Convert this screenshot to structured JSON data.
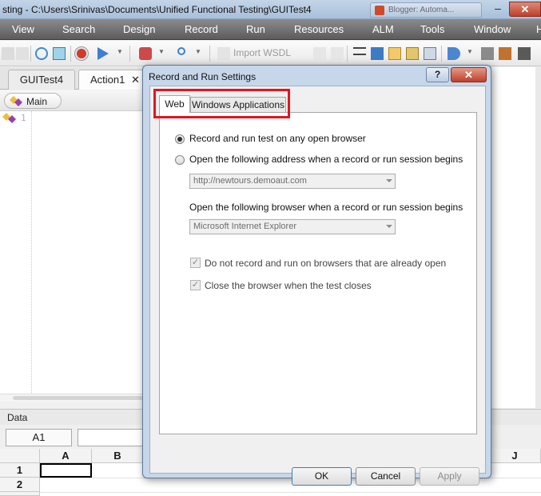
{
  "window": {
    "title": "sting - C:\\Users\\Srinivas\\Documents\\Unified Functional Testing\\GUITest4",
    "background_tab": "Blogger: Automa..."
  },
  "menu": {
    "items": [
      "View",
      "Search",
      "Design",
      "Record",
      "Run",
      "Resources",
      "ALM",
      "Tools",
      "Window",
      "H"
    ]
  },
  "toolbar": {
    "import_wsdl": "Import WSDL"
  },
  "doc_tabs": {
    "tab1": "GUITest4",
    "tab2": "Action1",
    "close": "✕"
  },
  "editor": {
    "main_label": "Main",
    "line_number": "1"
  },
  "data_pane": {
    "title": "Data",
    "cell_ref": "A1",
    "columns": [
      "A",
      "B",
      "J"
    ],
    "rows": [
      "1",
      "2"
    ]
  },
  "dialog": {
    "title": "Record and Run Settings",
    "help": "?",
    "close": "✕",
    "tabs": {
      "web": "Web",
      "windows_apps": "Windows Applications"
    },
    "radio_any_browser": "Record and run test on any open browser",
    "radio_address": "Open the following address when a record or run session begins",
    "address_value": "http://newtours.demoaut.com",
    "browser_label": "Open the following browser when a record or run session begins",
    "browser_value": "Microsoft Internet Explorer",
    "check_no_record": "Do not record and run on browsers that are already open",
    "check_close": "Close the browser when the test closes",
    "buttons": {
      "ok": "OK",
      "cancel": "Cancel",
      "apply": "Apply"
    }
  },
  "colors": {
    "menu_bar": "#6e6e6e",
    "dialog_frame": "#c7d7ea",
    "highlight": "#e4141e"
  }
}
